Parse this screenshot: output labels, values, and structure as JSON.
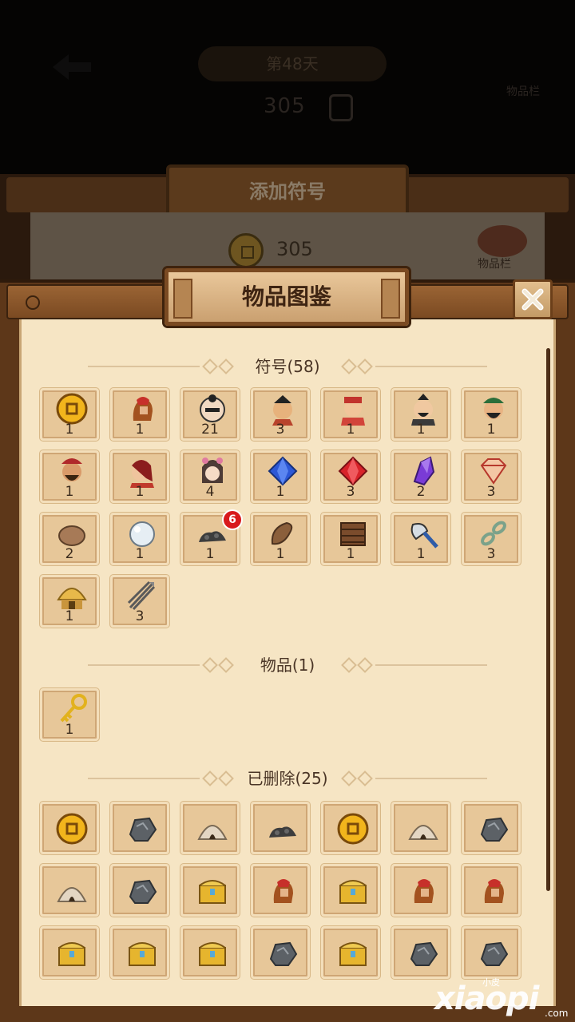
{
  "background": {
    "title_pill": "第48天",
    "coins": "305",
    "right_label": "物品栏",
    "panel_title": "添加符号",
    "panel_coins": "305",
    "bag_label": "物品栏"
  },
  "modal": {
    "title": "物品图鉴",
    "close_icon": "close-icon"
  },
  "sections": {
    "symbols": {
      "title": "符号(58)"
    },
    "items": {
      "title": "物品(1)"
    },
    "removed": {
      "title": "已删除(25)"
    }
  },
  "symbols": [
    {
      "icon": "coin",
      "count": "1"
    },
    {
      "icon": "spartan",
      "count": "1"
    },
    {
      "icon": "monk",
      "count": "21"
    },
    {
      "icon": "general",
      "count": "3"
    },
    {
      "icon": "official",
      "count": "1"
    },
    {
      "icon": "strategist",
      "count": "1"
    },
    {
      "icon": "green-general",
      "count": "1"
    },
    {
      "icon": "warlord",
      "count": "1"
    },
    {
      "icon": "red-warrior",
      "count": "1"
    },
    {
      "icon": "princess",
      "count": "4"
    },
    {
      "icon": "sapphire",
      "count": "1"
    },
    {
      "icon": "ruby",
      "count": "3"
    },
    {
      "icon": "amethyst",
      "count": "2"
    },
    {
      "icon": "diamond",
      "count": "3"
    },
    {
      "icon": "stone",
      "count": "2"
    },
    {
      "icon": "pearl",
      "count": "1"
    },
    {
      "icon": "coal",
      "count": "1"
    },
    {
      "icon": "sandal",
      "count": "1"
    },
    {
      "icon": "raft",
      "count": "1"
    },
    {
      "icon": "axe",
      "count": "1"
    },
    {
      "icon": "chain",
      "count": "3"
    },
    {
      "icon": "hut",
      "count": "1"
    },
    {
      "icon": "arrows",
      "count": "3"
    }
  ],
  "coal_badge": "6",
  "items": [
    {
      "icon": "key",
      "count": "1"
    }
  ],
  "removed": [
    {
      "icon": "coin"
    },
    {
      "icon": "ore"
    },
    {
      "icon": "tent"
    },
    {
      "icon": "coal"
    },
    {
      "icon": "coin"
    },
    {
      "icon": "tent"
    },
    {
      "icon": "ore"
    },
    {
      "icon": "tent"
    },
    {
      "icon": "ore"
    },
    {
      "icon": "chest"
    },
    {
      "icon": "spartan"
    },
    {
      "icon": "chest"
    },
    {
      "icon": "spartan"
    },
    {
      "icon": "spartan"
    },
    {
      "icon": "chest"
    },
    {
      "icon": "chest"
    },
    {
      "icon": "chest"
    },
    {
      "icon": "ore"
    },
    {
      "icon": "chest"
    },
    {
      "icon": "ore"
    },
    {
      "icon": "ore"
    }
  ],
  "watermark": {
    "main": "xiaopi",
    "sub": "小皮",
    "com": ".com"
  }
}
